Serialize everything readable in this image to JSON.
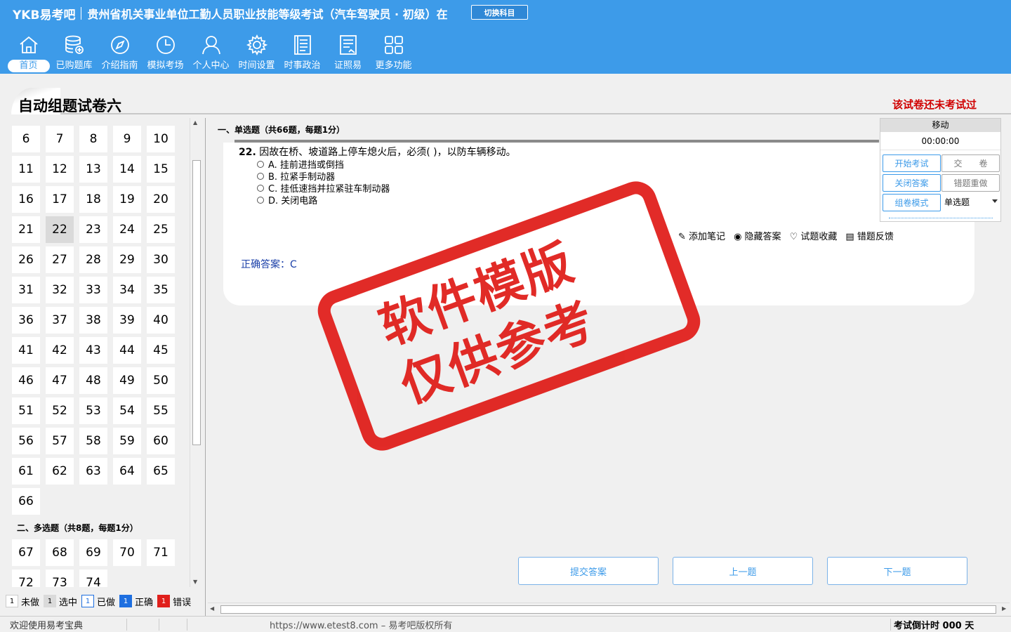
{
  "header": {
    "logo": "YKB易考吧",
    "exam_title": "贵州省机关事业单位工勤人员职业技能等级考试（汽车驾驶员 · 初级）在",
    "switch_label": "切换科目",
    "nav": [
      {
        "label": "首页",
        "icon": "home-icon"
      },
      {
        "label": "已购题库",
        "icon": "database-icon"
      },
      {
        "label": "介绍指南",
        "icon": "compass-icon"
      },
      {
        "label": "模拟考场",
        "icon": "clock-icon"
      },
      {
        "label": "个人中心",
        "icon": "user-icon"
      },
      {
        "label": "时间设置",
        "icon": "gear-icon"
      },
      {
        "label": "时事政治",
        "icon": "news-icon"
      },
      {
        "label": "证照易",
        "icon": "certificate-icon"
      },
      {
        "label": "更多功能",
        "icon": "grid-icon"
      }
    ]
  },
  "paper": {
    "title": "自动组题试卷六",
    "status": "该试卷还未考试过"
  },
  "left": {
    "numbers_single": [
      "6",
      "7",
      "8",
      "9",
      "10",
      "11",
      "12",
      "13",
      "14",
      "15",
      "16",
      "17",
      "18",
      "19",
      "20",
      "21",
      "22",
      "23",
      "24",
      "25",
      "26",
      "27",
      "28",
      "29",
      "30",
      "31",
      "32",
      "33",
      "34",
      "35",
      "36",
      "37",
      "38",
      "39",
      "40",
      "41",
      "42",
      "43",
      "44",
      "45",
      "46",
      "47",
      "48",
      "49",
      "50",
      "51",
      "52",
      "53",
      "54",
      "55",
      "56",
      "57",
      "58",
      "59",
      "60",
      "61",
      "62",
      "63",
      "64",
      "65",
      "66"
    ],
    "current": "22",
    "section2_title": "二、多选题（共8题，每题1分）",
    "numbers_multi": [
      "67",
      "68",
      "69",
      "70",
      "71",
      "72",
      "73",
      "74"
    ]
  },
  "legend": [
    {
      "count": "1",
      "label": "未做",
      "color": "#ffffff"
    },
    {
      "count": "1",
      "label": "选中",
      "color": "#dadada"
    },
    {
      "count": "1",
      "label": "已做",
      "color": "#ffffff"
    },
    {
      "count": "1",
      "label": "正确",
      "color": "#1e6fe0"
    },
    {
      "count": "1",
      "label": "错误",
      "color": "#e0201c"
    }
  ],
  "question": {
    "section_title": "一、单选题（共66题，每题1分）",
    "number": "22.",
    "stem": "因故在桥、坡道路上停车熄火后，必须( )，以防车辆移动。",
    "options": [
      "A. 挂前进挡或倒挡",
      "B. 拉紧手制动器",
      "C. 挂低速挡并拉紧驻车制动器",
      "D. 关闭电路"
    ],
    "answer": "正确答案：C",
    "tools": [
      "添加笔记",
      "隐藏答案",
      "试题收藏",
      "错题反馈"
    ]
  },
  "side": {
    "head": "移动",
    "timer": "00:00:00",
    "start": "开始考试",
    "submit_paper": "交　　卷",
    "close_answer": "关闭答案",
    "redo_wrong": "错题重做",
    "compose_mode": "组卷模式",
    "mode_value": "单选题"
  },
  "buttons": {
    "submit": "提交答案",
    "prev": "上一题",
    "next": "下一题"
  },
  "statusbar": {
    "welcome": "欢迎使用易考宝典",
    "copyright": "https://www.etest8.com – 易考吧版权所有",
    "countdown": "考试倒计时 000 天"
  },
  "stamp": {
    "line1": "软件模版",
    "line2": "仅供参考"
  },
  "colors": {
    "header": "#3d9be9",
    "accent_red": "#d00000",
    "stamp": "#e0201c"
  }
}
